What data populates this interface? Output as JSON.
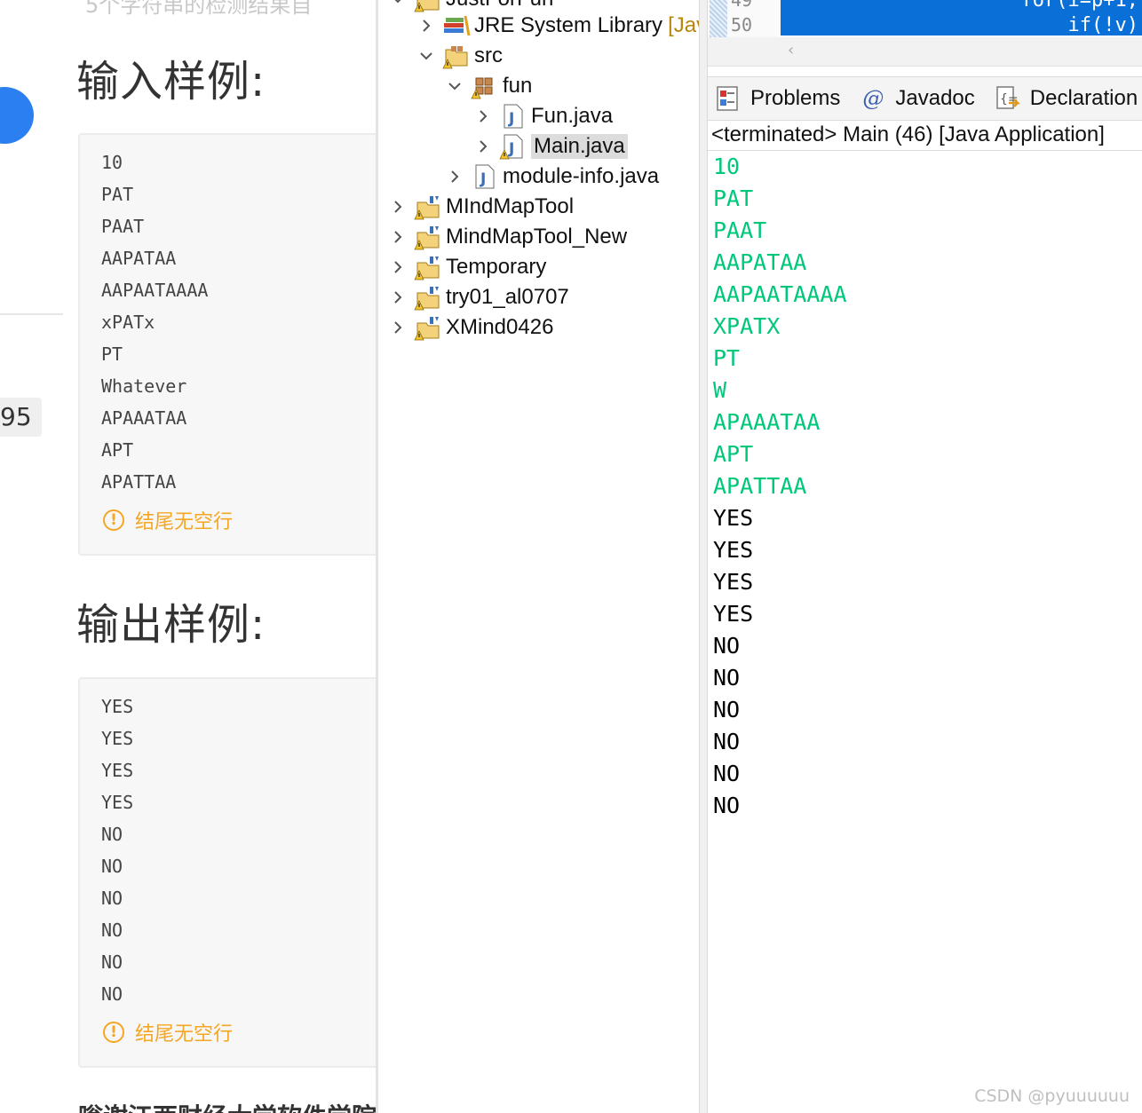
{
  "problem_page": {
    "top_cut_text": "5个字符串的检测结果自",
    "side_number": "95",
    "input_title": "输入样例:",
    "input_lines": [
      "10",
      "PAT",
      "PAAT",
      "AAPATAA",
      "AAPAATAAAA",
      "xPATx",
      "PT",
      "Whatever",
      "APAAATAA",
      "APT",
      "APATTAA"
    ],
    "input_note": "结尾无空行",
    "output_title": "输出样例:",
    "output_lines": [
      "YES",
      "YES",
      "YES",
      "YES",
      "NO",
      "NO",
      "NO",
      "NO",
      "NO",
      "NO"
    ],
    "output_note": "结尾无空行",
    "footer_cut_text": "嗡谢江西财经大学软件学院"
  },
  "explorer": {
    "top_cut_label": "JustForFun",
    "items": [
      {
        "label": "JRE System Library",
        "suffix": "[Jav",
        "icon": "library-icon",
        "expanded": false
      },
      {
        "label": "src",
        "icon": "source-folder-icon",
        "expanded": true
      },
      {
        "label": "fun",
        "icon": "package-icon",
        "expanded": true
      },
      {
        "label": "Fun.java",
        "icon": "java-file-icon",
        "expanded": false
      },
      {
        "label": "Main.java",
        "icon": "java-file-warning-icon",
        "expanded": false,
        "selected": true
      },
      {
        "label": "module-info.java",
        "icon": "java-file-icon",
        "expanded": false
      },
      {
        "label": "MIndMapTool",
        "icon": "project-warning-icon",
        "expanded": false
      },
      {
        "label": "MindMapTool_New",
        "icon": "project-warning-icon",
        "expanded": false
      },
      {
        "label": "Temporary",
        "icon": "project-warning-icon",
        "expanded": false
      },
      {
        "label": "try01_al0707",
        "icon": "project-warning-icon",
        "expanded": false
      },
      {
        "label": "XMind0426",
        "icon": "project-warning-icon",
        "expanded": false
      }
    ]
  },
  "editor": {
    "line_numbers": [
      "49",
      "50"
    ],
    "code_lines": [
      "    for(i=p+1;",
      "      if(!v)"
    ]
  },
  "views": {
    "tabs": [
      {
        "label": "Problems",
        "icon": "problems-icon"
      },
      {
        "label": "Javadoc",
        "icon": "javadoc-icon"
      },
      {
        "label": "Declaration",
        "icon": "declaration-icon"
      }
    ],
    "console_header": "<terminated> Main (46) [Java Application]"
  },
  "console": {
    "input_lines": [
      "10",
      "PAT",
      "PAAT",
      "AAPATAA",
      "AAPAATAAAA",
      "XPATX",
      "PT",
      "W",
      "APAAATAA",
      "APT",
      "APATTAA"
    ],
    "output_lines": [
      "YES",
      "YES",
      "YES",
      "YES",
      "NO",
      "NO",
      "NO",
      "NO",
      "NO",
      "NO"
    ]
  },
  "watermark": "CSDN @pyuuuuuu",
  "colors": {
    "console_input": "#00c87a",
    "warning_orange": "#f5a623",
    "editor_highlight": "#0a6fd6",
    "brand_blue": "#2b7ff0"
  }
}
